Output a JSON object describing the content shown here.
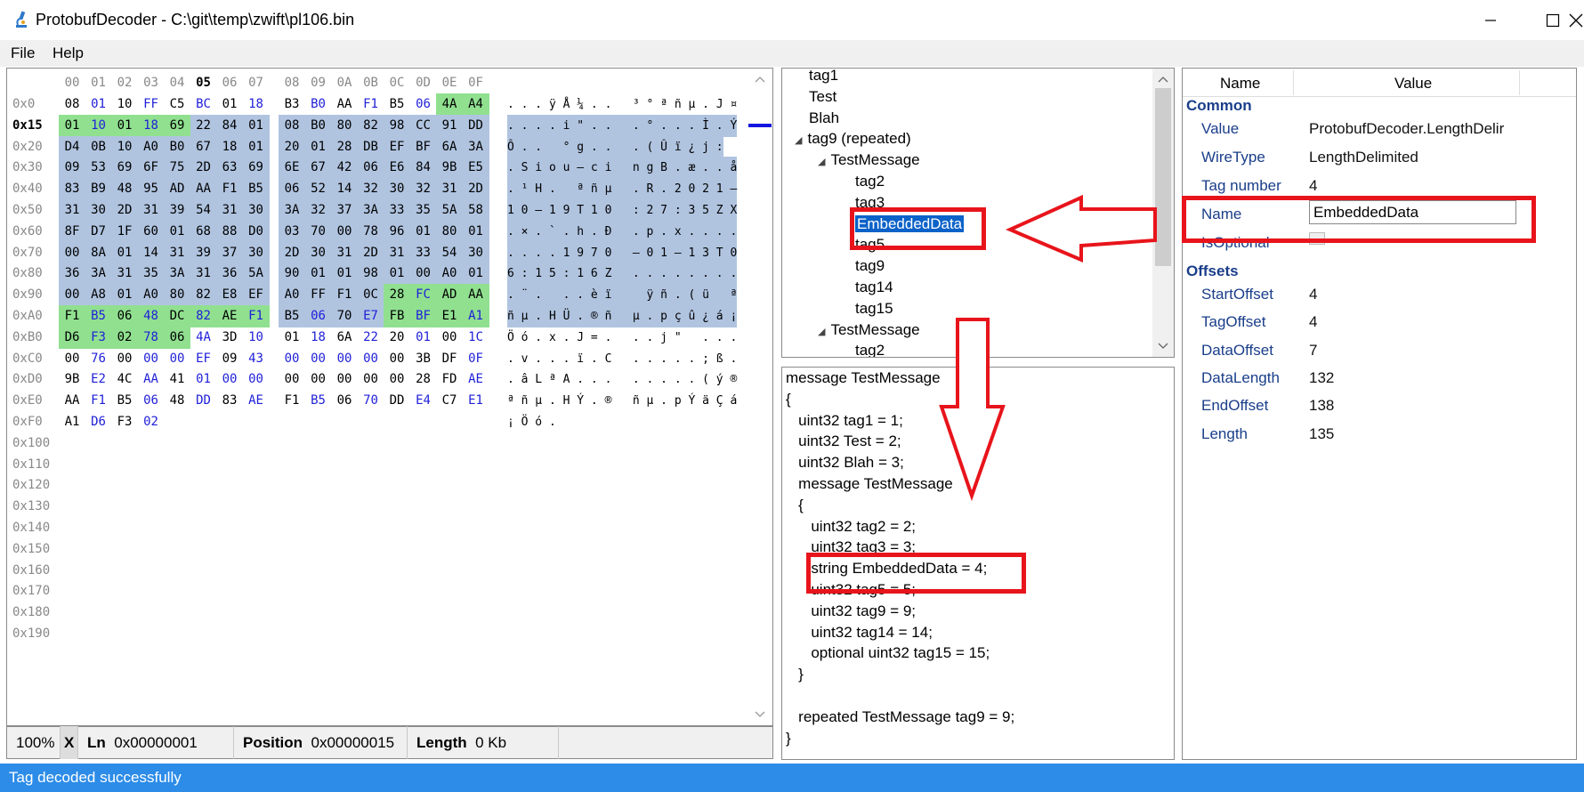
{
  "window": {
    "title": "ProtobufDecoder - C:\\git\\temp\\zwift\\pl106.bin"
  },
  "menu": {
    "items": [
      {
        "label": "File"
      },
      {
        "label": "Help"
      }
    ]
  },
  "hex": {
    "column_headers": [
      "00",
      "01",
      "02",
      "03",
      "04",
      "05",
      "06",
      "07",
      "08",
      "09",
      "0A",
      "0B",
      "0C",
      "0D",
      "0E",
      "0F"
    ],
    "rows": [
      {
        "offset": "0x0",
        "bytes": [
          "08",
          "01",
          "10",
          "FF",
          "C5",
          "BC",
          "01",
          "18",
          "B3",
          "B0",
          "AA",
          "F1",
          "B5",
          "06",
          "4A",
          "A4"
        ],
        "ascii": ". . . ÿ Å ¼ . .   ³ ° ª ñ µ . J ¤"
      },
      {
        "offset": "0x15",
        "bytes": [
          "01",
          "10",
          "01",
          "18",
          "69",
          "22",
          "84",
          "01",
          "08",
          "B0",
          "80",
          "82",
          "98",
          "CC",
          "91",
          "DD"
        ],
        "ascii": ". . . . i \" . .   . ° . . . Ì . Ý"
      },
      {
        "offset": "0x20",
        "bytes": [
          "D4",
          "0B",
          "10",
          "A0",
          "B0",
          "67",
          "18",
          "01",
          "20",
          "01",
          "28",
          "DB",
          "EF",
          "BF",
          "6A",
          "3A"
        ],
        "ascii": "Ô . .   ° g . .   . ( Û ï ¿ j :"
      },
      {
        "offset": "0x30",
        "bytes": [
          "09",
          "53",
          "69",
          "6F",
          "75",
          "2D",
          "63",
          "69",
          "6E",
          "67",
          "42",
          "06",
          "E6",
          "84",
          "9B",
          "E5"
        ],
        "ascii": ". S i o u – c i   n g B . æ . . å"
      },
      {
        "offset": "0x40",
        "bytes": [
          "83",
          "B9",
          "48",
          "95",
          "AD",
          "AA",
          "F1",
          "B5",
          "06",
          "52",
          "14",
          "32",
          "30",
          "32",
          "31",
          "2D"
        ],
        "ascii": ". ¹ H .   ª ñ µ   . R . 2 0 2 1 –"
      },
      {
        "offset": "0x50",
        "bytes": [
          "31",
          "30",
          "2D",
          "31",
          "39",
          "54",
          "31",
          "30",
          "3A",
          "32",
          "37",
          "3A",
          "33",
          "35",
          "5A",
          "58"
        ],
        "ascii": "1 0 – 1 9 T 1 0   : 2 7 : 3 5 Z X"
      },
      {
        "offset": "0x60",
        "bytes": [
          "8F",
          "D7",
          "1F",
          "60",
          "01",
          "68",
          "88",
          "D0",
          "03",
          "70",
          "00",
          "78",
          "96",
          "01",
          "80",
          "01"
        ],
        "ascii": ". × . ` . h . Ð   . p . x . . . ."
      },
      {
        "offset": "0x70",
        "bytes": [
          "00",
          "8A",
          "01",
          "14",
          "31",
          "39",
          "37",
          "30",
          "2D",
          "30",
          "31",
          "2D",
          "31",
          "33",
          "54",
          "30"
        ],
        "ascii": ". . . . 1 9 7 0   – 0 1 – 1 3 T 0"
      },
      {
        "offset": "0x80",
        "bytes": [
          "36",
          "3A",
          "31",
          "35",
          "3A",
          "31",
          "36",
          "5A",
          "90",
          "01",
          "01",
          "98",
          "01",
          "00",
          "A0",
          "01"
        ],
        "ascii": "6 : 1 5 : 1 6 Z   . . . . . . . ."
      },
      {
        "offset": "0x90",
        "bytes": [
          "00",
          "A8",
          "01",
          "A0",
          "80",
          "82",
          "E8",
          "EF",
          "A0",
          "FF",
          "F1",
          "0C",
          "28",
          "FC",
          "AD",
          "AA"
        ],
        "ascii": ". ¨ .   . . è ï     ÿ ñ . ( ü   ª"
      },
      {
        "offset": "0xA0",
        "bytes": [
          "F1",
          "B5",
          "06",
          "48",
          "DC",
          "82",
          "AE",
          "F1",
          "B5",
          "06",
          "70",
          "E7",
          "FB",
          "BF",
          "E1",
          "A1"
        ],
        "ascii": "ñ µ . H Ü . ® ñ   µ . p ç û ¿ á ¡"
      },
      {
        "offset": "0xB0",
        "bytes": [
          "D6",
          "F3",
          "02",
          "78",
          "06",
          "4A",
          "3D",
          "10",
          "01",
          "18",
          "6A",
          "22",
          "20",
          "01",
          "00",
          "1C"
        ],
        "ascii": "Ö ó . x . J = .   . . j \"   . . ."
      },
      {
        "offset": "0xC0",
        "bytes": [
          "00",
          "76",
          "00",
          "00",
          "00",
          "EF",
          "09",
          "43",
          "00",
          "00",
          "00",
          "00",
          "00",
          "3B",
          "DF",
          "0F"
        ],
        "ascii": ". v . . . ï . C   . . . . . ; ß ."
      },
      {
        "offset": "0xD0",
        "bytes": [
          "9B",
          "E2",
          "4C",
          "AA",
          "41",
          "01",
          "00",
          "00",
          "00",
          "00",
          "00",
          "00",
          "00",
          "28",
          "FD",
          "AE"
        ],
        "ascii": ". â L ª A . . .   . . . . . ( ý ®"
      },
      {
        "offset": "0xE0",
        "bytes": [
          "AA",
          "F1",
          "B5",
          "06",
          "48",
          "DD",
          "83",
          "AE",
          "F1",
          "B5",
          "06",
          "70",
          "DD",
          "E4",
          "C7",
          "E1"
        ],
        "ascii": "ª ñ µ . H Ý . ®   ñ µ . p Ý ä Ç á"
      },
      {
        "offset": "0xF0",
        "bytes": [
          "A1",
          "D6",
          "F3",
          "02"
        ],
        "ascii": "¡ Ö ó ."
      },
      {
        "offset": "0x100",
        "bytes": [],
        "ascii": ""
      },
      {
        "offset": "0x110",
        "bytes": [],
        "ascii": ""
      },
      {
        "offset": "0x120",
        "bytes": [],
        "ascii": ""
      },
      {
        "offset": "0x130",
        "bytes": [],
        "ascii": ""
      },
      {
        "offset": "0x140",
        "bytes": [],
        "ascii": ""
      },
      {
        "offset": "0x150",
        "bytes": [],
        "ascii": ""
      },
      {
        "offset": "0x160",
        "bytes": [],
        "ascii": ""
      },
      {
        "offset": "0x170",
        "bytes": [],
        "ascii": ""
      },
      {
        "offset": "0x180",
        "bytes": [],
        "ascii": ""
      },
      {
        "offset": "0x190",
        "bytes": [],
        "ascii": ""
      }
    ]
  },
  "hex_status": {
    "zoom": "100%",
    "x": "X",
    "ln_label": "Ln",
    "ln_value": "0x00000001",
    "position_label": "Position",
    "position_value": "0x00000015",
    "length_label": "Length",
    "length_value": "0 Kb"
  },
  "tree": {
    "nodes": [
      {
        "label": "tag1",
        "level": 0,
        "expander": ""
      },
      {
        "label": "Test",
        "level": 0,
        "expander": ""
      },
      {
        "label": "Blah",
        "level": 0,
        "expander": ""
      },
      {
        "label": "tag9 (repeated)",
        "level": 0,
        "expander": "◢"
      },
      {
        "label": "TestMessage",
        "level": 1,
        "expander": "◢"
      },
      {
        "label": "tag2",
        "level": 2,
        "expander": ""
      },
      {
        "label": "tag3",
        "level": 2,
        "expander": ""
      },
      {
        "label": "EmbeddedData",
        "level": 2,
        "expander": "",
        "selected": true
      },
      {
        "label": "tag5",
        "level": 2,
        "expander": ""
      },
      {
        "label": "tag9",
        "level": 2,
        "expander": ""
      },
      {
        "label": "tag14",
        "level": 2,
        "expander": ""
      },
      {
        "label": "tag15",
        "level": 2,
        "expander": ""
      },
      {
        "label": "TestMessage",
        "level": 1,
        "expander": "◢"
      },
      {
        "label": "tag2",
        "level": 2,
        "expander": ""
      }
    ]
  },
  "code": {
    "lines": [
      "message TestMessage",
      "{",
      "   uint32 tag1 = 1;",
      "   uint32 Test = 2;",
      "   uint32 Blah = 3;",
      "   message TestMessage",
      "   {",
      "      uint32 tag2 = 2;",
      "      uint32 tag3 = 3;",
      "      string EmbeddedData = 4;",
      "      uint32 tag5 = 5;",
      "      uint32 tag9 = 9;",
      "      uint32 tag14 = 14;",
      "      optional uint32 tag15 = 15;",
      "   }",
      "",
      "   repeated TestMessage tag9 = 9;",
      "}"
    ]
  },
  "props": {
    "header_name": "Name",
    "header_value": "Value",
    "categories": [
      {
        "name": "Common",
        "items": [
          {
            "key": "Value",
            "value": "ProtobufDecoder.LengthDelir"
          },
          {
            "key": "WireType",
            "value": "LengthDelimited"
          },
          {
            "key": "Tag number",
            "value": "4"
          },
          {
            "key": "Name",
            "value": "EmbeddedData",
            "editable": true
          },
          {
            "key": "IsOptional",
            "value": "",
            "checkbox": true
          }
        ]
      },
      {
        "name": "Offsets",
        "items": [
          {
            "key": "StartOffset",
            "value": "4"
          },
          {
            "key": "TagOffset",
            "value": "4"
          },
          {
            "key": "DataOffset",
            "value": "7"
          },
          {
            "key": "DataLength",
            "value": "132"
          },
          {
            "key": "EndOffset",
            "value": "138"
          },
          {
            "key": "Length",
            "value": "135"
          }
        ]
      }
    ]
  },
  "status": {
    "text": "Tag decoded successfully"
  },
  "colors": {
    "hex_selected_bg": "#b0c4e0",
    "hex_highlight_bg": "#90e090",
    "blue_byte": "#1f1fd8",
    "status_bar": "#2c8ce8",
    "annotation_red": "#e8141b",
    "tree_selection": "#0b62c8"
  }
}
